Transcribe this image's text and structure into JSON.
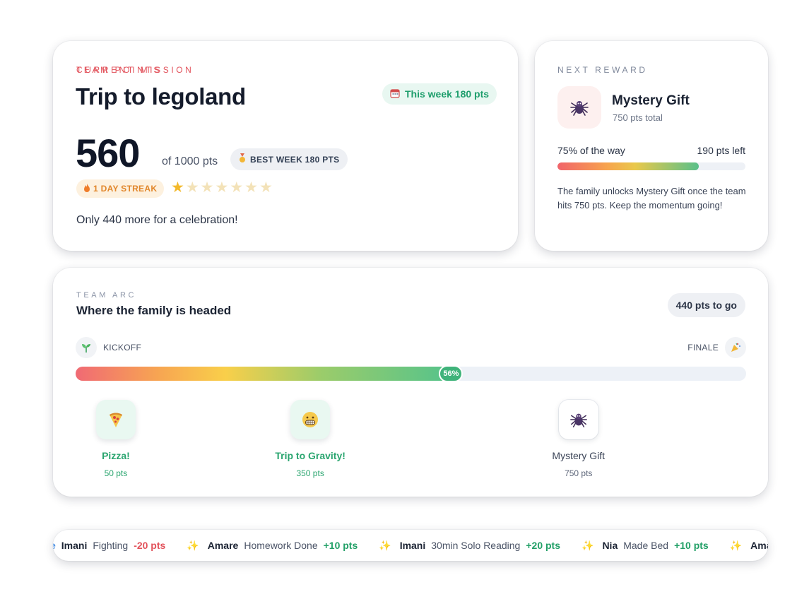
{
  "mission": {
    "eyebrow": "CURRENT MISSION",
    "title": "Trip to legoland",
    "week_label": "This week 180 pts",
    "team_points_label": "TEAM POINTS",
    "score": "560",
    "score_total": "of 1000 pts",
    "best_week": "BEST WEEK 180 PTS",
    "streak": "1 DAY STREAK",
    "stars_filled": 1,
    "stars_total": 7,
    "message": "Only 440 more for a celebration!"
  },
  "reward": {
    "eyebrow": "NEXT REWARD",
    "name": "Mystery Gift",
    "total": "750 pts total",
    "progress_label": "75% of the way",
    "progress": 0.75,
    "left_label": "190 pts left",
    "message": "The family unlocks Mystery Gift once the team hits 750 pts. Keep the momentum going!",
    "icon": "spider-icon"
  },
  "arc": {
    "eyebrow": "TEAM ARC",
    "title": "Where the family is headed",
    "to_go": "440 pts to go",
    "start_label": "KICKOFF",
    "end_label": "FINALE",
    "progress": 0.56,
    "progress_label": "56%",
    "milestones": [
      {
        "name": "Pizza!",
        "pts": "50 pts",
        "position": 0.06,
        "done": true,
        "icon": "pizza-icon"
      },
      {
        "name": "Trip to Gravity!",
        "pts": "350 pts",
        "position": 0.35,
        "done": true,
        "icon": "grimace-face-icon"
      },
      {
        "name": "Mystery Gift",
        "pts": "750 pts",
        "position": 0.75,
        "done": false,
        "icon": "spider-icon"
      }
    ]
  },
  "ticker": {
    "items": [
      {
        "name": "Imani",
        "activity": "Fighting",
        "points": "-20 pts",
        "positive": false
      },
      {
        "name": "Amare",
        "activity": "Homework Done",
        "points": "+10 pts",
        "positive": true
      },
      {
        "name": "Imani",
        "activity": "30min Solo Reading",
        "points": "+20 pts",
        "positive": true
      },
      {
        "name": "Nia",
        "activity": "Made Bed",
        "points": "+10 pts",
        "positive": true
      },
      {
        "name": "Amare",
        "activity": "",
        "points": "",
        "positive": true
      }
    ]
  },
  "colors": {
    "accent_red": "#e2525b",
    "accent_green": "#2aa56f",
    "streak_orange": "#e1862a"
  }
}
